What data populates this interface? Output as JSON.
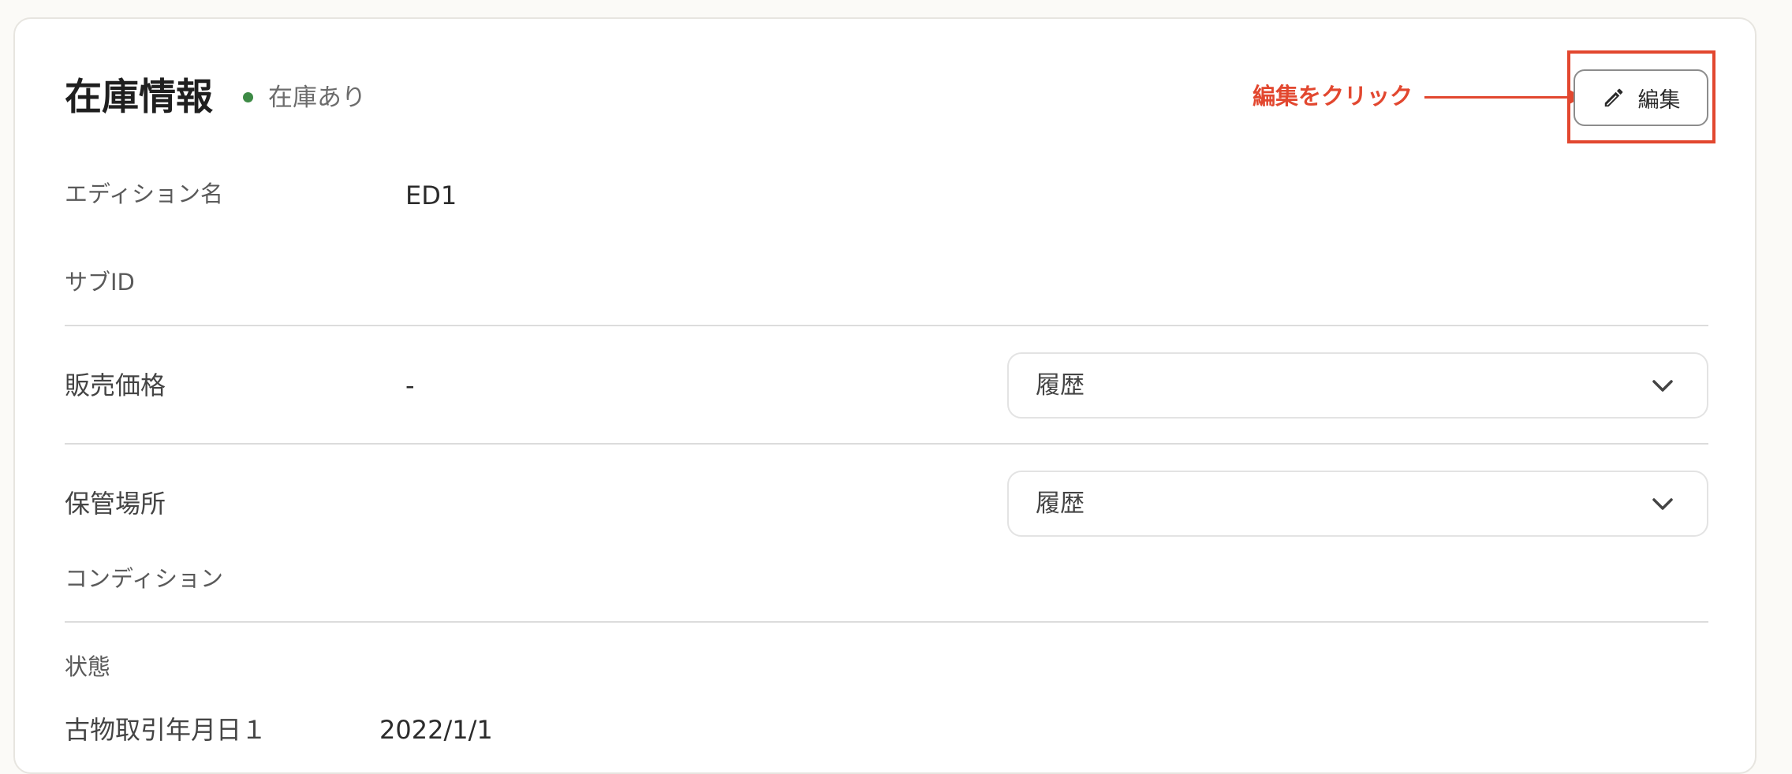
{
  "header": {
    "title": "在庫情報",
    "status_text": "在庫あり",
    "status_color": "#3d8a45"
  },
  "annotation": {
    "text": "編集をクリック",
    "color": "#e2472f"
  },
  "edit_button": {
    "label": "編集",
    "icon": "pencil-icon"
  },
  "fields": {
    "edition_name": {
      "label": "エディション名",
      "value": "ED1"
    },
    "sub_id": {
      "label": "サブID",
      "value": ""
    },
    "sale_price": {
      "label": "販売価格",
      "value": "-",
      "history_label": "履歴"
    },
    "storage_location": {
      "label": "保管場所",
      "history_label": "履歴"
    },
    "condition": {
      "label": "コンディション"
    },
    "state": {
      "label": "状態"
    },
    "antique_trade_date_1": {
      "label": "古物取引年月日１",
      "value": "2022/1/1"
    }
  }
}
